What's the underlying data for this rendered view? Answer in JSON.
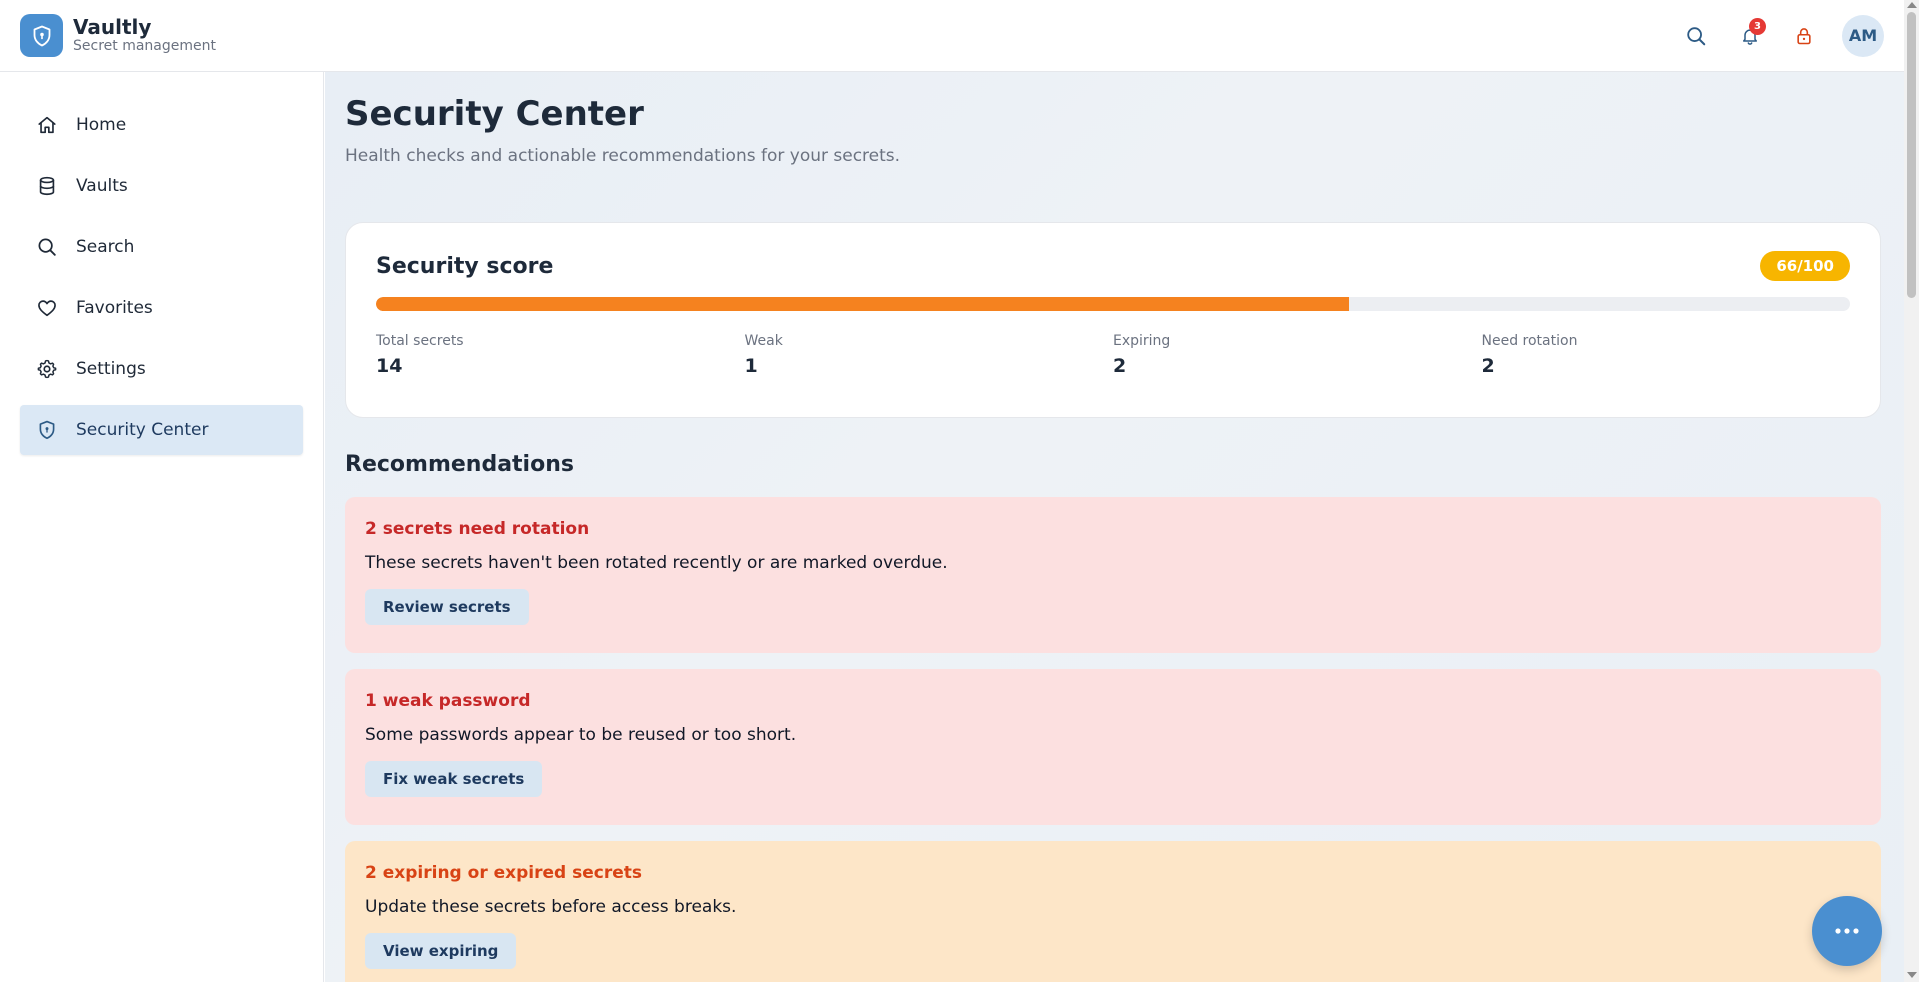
{
  "app": {
    "name": "Vaultly",
    "subtitle": "Secret management"
  },
  "header": {
    "notifications_count": "3",
    "avatar_initials": "AM"
  },
  "sidebar": {
    "items": [
      {
        "label": "Home",
        "icon": "home-icon"
      },
      {
        "label": "Vaults",
        "icon": "database-icon"
      },
      {
        "label": "Search",
        "icon": "search-icon"
      },
      {
        "label": "Favorites",
        "icon": "heart-icon"
      },
      {
        "label": "Settings",
        "icon": "gear-icon"
      },
      {
        "label": "Security Center",
        "icon": "shield-icon",
        "active": true
      }
    ]
  },
  "page": {
    "title": "Security Center",
    "subtitle": "Health checks and actionable recommendations for your secrets."
  },
  "score": {
    "title": "Security score",
    "badge": "66/100",
    "progress_percent": 66,
    "stats": [
      {
        "label": "Total secrets",
        "value": "14"
      },
      {
        "label": "Weak",
        "value": "1"
      },
      {
        "label": "Expiring",
        "value": "2"
      },
      {
        "label": "Need rotation",
        "value": "2"
      }
    ]
  },
  "recommendations": {
    "title": "Recommendations",
    "items": [
      {
        "title": "2 secrets need rotation",
        "body": "These secrets haven't been rotated recently or are marked overdue.",
        "action": "Review secrets",
        "severity": "red"
      },
      {
        "title": "1 weak password",
        "body": "Some passwords appear to be reused or too short.",
        "action": "Fix weak secrets",
        "severity": "red"
      },
      {
        "title": "2 expiring or expired secrets",
        "body": "Update these secrets before access breaks.",
        "action": "View expiring",
        "severity": "orange"
      }
    ]
  },
  "colors": {
    "brand": "#4a8fd0",
    "progress": "#f5821f",
    "score_badge": "#f7b500",
    "danger_bg": "#fce0e0",
    "warning_bg": "#fde6c8"
  }
}
